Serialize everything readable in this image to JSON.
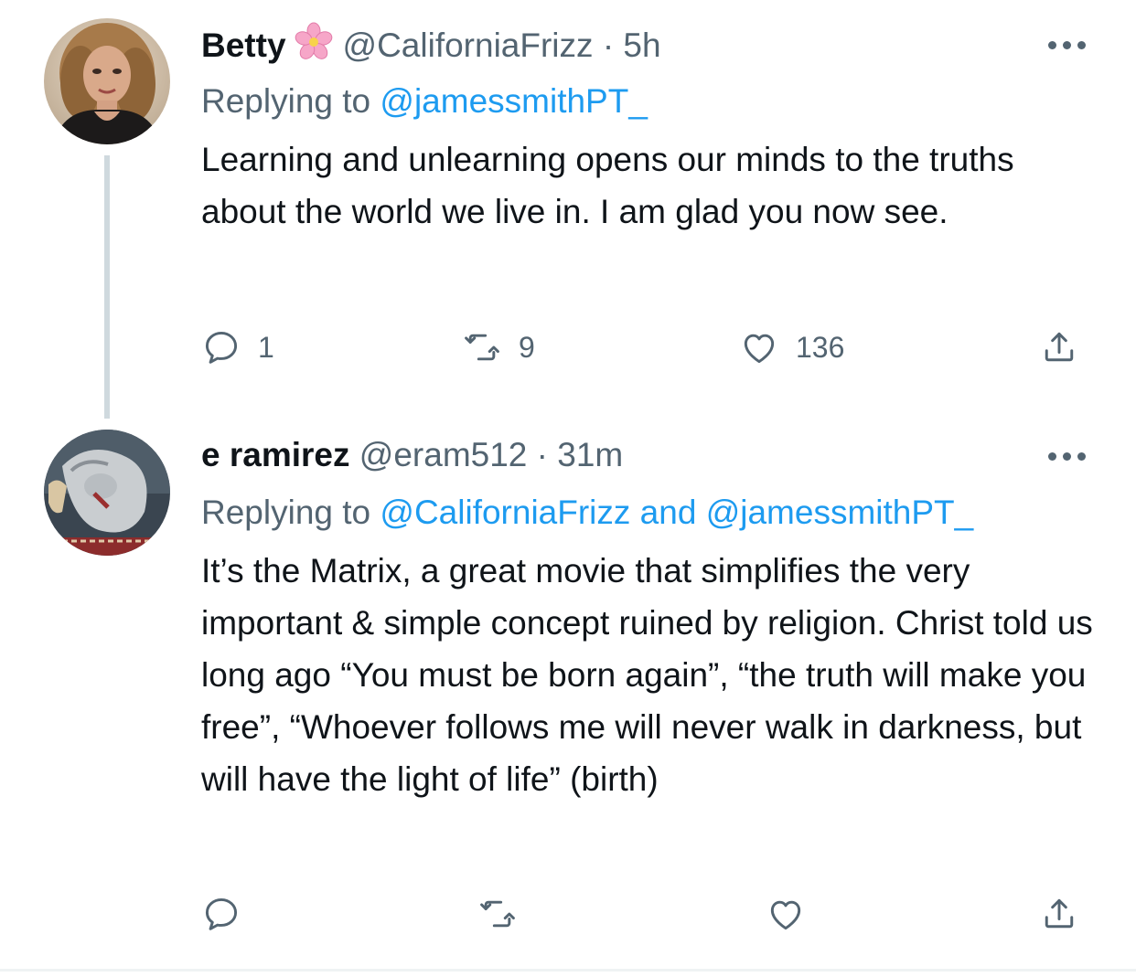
{
  "tweets": [
    {
      "name": "Betty",
      "handle": "@CaliforniaFrizz",
      "separator": "·",
      "time": "5h",
      "replying_prefix": "Replying to",
      "replying_mentions": [
        "@jamessmithPT_"
      ],
      "replying_joiner": "",
      "text": "Learning and unlearning opens our minds to the truths about the world we live in. I am glad you now see.",
      "reply_count": "1",
      "retweet_count": "9",
      "like_count": "136",
      "avatar_icon": "user-avatar-photo",
      "name_badge_icon": "cherry-blossom-icon"
    },
    {
      "name": "e ramirez",
      "handle": "@eram512",
      "separator": "·",
      "time": "31m",
      "replying_prefix": "Replying to",
      "replying_mentions": [
        "@CaliforniaFrizz",
        "@jamessmithPT_"
      ],
      "replying_joiner": "and",
      "text": "It’s the Matrix, a great movie that simplifies the very important & simple concept ruined by religion. Christ told us long ago “You must be born again”, “the truth will make you free”, “Whoever follows me will never walk in darkness, but will have the light of life” (birth)",
      "reply_count": "",
      "retweet_count": "",
      "like_count": "",
      "avatar_icon": "user-avatar-photo"
    }
  ],
  "colors": {
    "text_primary": "#0f1419",
    "text_secondary": "#536471",
    "link": "#1d9bf0",
    "thread_line": "#cfd9de",
    "divider": "#eff3f4"
  }
}
